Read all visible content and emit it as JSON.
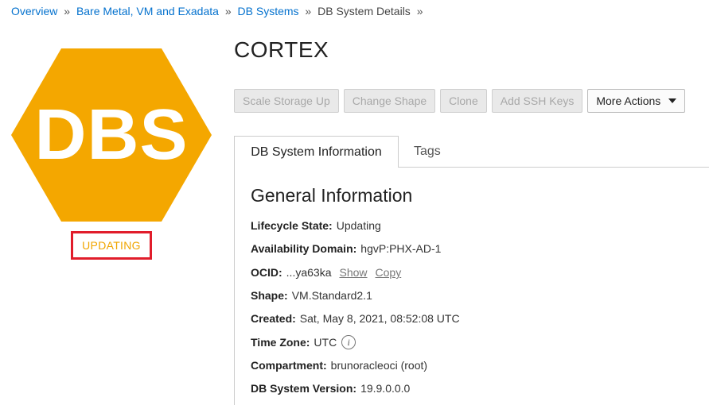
{
  "breadcrumb": {
    "items": [
      "Overview",
      "Bare Metal, VM and Exadata",
      "DB Systems"
    ],
    "current": "DB System Details",
    "separator": "»"
  },
  "badge": {
    "text": "DBS",
    "color": "#f4a700"
  },
  "status": {
    "label": "UPDATING",
    "text_color": "#f0a500",
    "highlight_color": "#e11d2b"
  },
  "title": "CORTEX",
  "actions": {
    "scale_storage": "Scale Storage Up",
    "change_shape": "Change Shape",
    "clone": "Clone",
    "add_ssh": "Add SSH Keys",
    "more_actions": "More Actions"
  },
  "tabs": {
    "info": "DB System Information",
    "tags": "Tags"
  },
  "general": {
    "heading": "General Information",
    "lifecycle_label": "Lifecycle State:",
    "lifecycle_value": "Updating",
    "ad_label": "Availability Domain:",
    "ad_value": "hgvP:PHX-AD-1",
    "ocid_label": "OCID:",
    "ocid_value": "...ya63ka",
    "ocid_show": "Show",
    "ocid_copy": "Copy",
    "shape_label": "Shape:",
    "shape_value": "VM.Standard2.1",
    "created_label": "Created:",
    "created_value": "Sat, May 8, 2021, 08:52:08 UTC",
    "timezone_label": "Time Zone:",
    "timezone_value": "UTC",
    "timezone_icon": "info-icon",
    "compartment_label": "Compartment:",
    "compartment_value": "brunoracleoci (root)",
    "version_label": "DB System Version:",
    "version_value": "19.9.0.0.0"
  }
}
